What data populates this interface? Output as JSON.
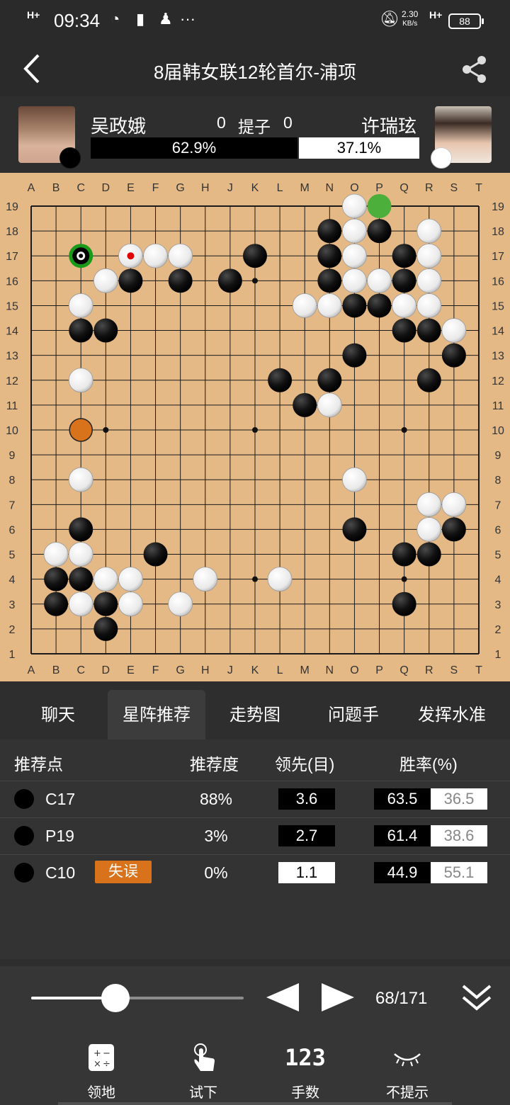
{
  "status": {
    "network": "H+",
    "time": "09:34",
    "speed": "2.30",
    "speed_unit": "KB/s",
    "net2": "H+",
    "battery": "88"
  },
  "header": {
    "title": "8届韩女联12轮首尔-浦项",
    "back_icon": "chevron-left-icon",
    "share_icon": "share-icon"
  },
  "players": {
    "black": {
      "name": "吴政娥",
      "captures": "0",
      "stone": "black"
    },
    "white": {
      "name": "许瑞玹",
      "captures": "0",
      "stone": "white"
    },
    "captures_label": "提子",
    "black_winrate": "62.9%",
    "white_winrate": "37.1%",
    "black_winrate_value": 62.9
  },
  "board": {
    "size": 19,
    "columns": [
      "A",
      "B",
      "C",
      "D",
      "E",
      "F",
      "G",
      "H",
      "J",
      "K",
      "L",
      "M",
      "N",
      "O",
      "P",
      "Q",
      "R",
      "S",
      "T"
    ],
    "rows": [
      "19",
      "18",
      "17",
      "16",
      "15",
      "14",
      "13",
      "12",
      "11",
      "10",
      "9",
      "8",
      "7",
      "6",
      "5",
      "4",
      "3",
      "2",
      "1"
    ],
    "black_stones": [
      "N18",
      "P18",
      "N17",
      "Q17",
      "K17",
      "E16",
      "G16",
      "J16",
      "N16",
      "Q16",
      "O15",
      "P15",
      "C14",
      "D14",
      "Q14",
      "R14",
      "O13",
      "S13",
      "L12",
      "N12",
      "R12",
      "M11",
      "C6",
      "O6",
      "S6",
      "F5",
      "Q5",
      "R5",
      "B4",
      "C4",
      "B3",
      "D3",
      "Q3",
      "D2"
    ],
    "white_stones": [
      "O19",
      "O18",
      "R18",
      "E17",
      "F17",
      "G17",
      "O17",
      "R17",
      "D16",
      "O16",
      "P16",
      "R16",
      "C15",
      "M15",
      "N15",
      "Q15",
      "R15",
      "S14",
      "C12",
      "N11",
      "C8",
      "O8",
      "R7",
      "S7",
      "R6",
      "B5",
      "C5",
      "D4",
      "E4",
      "H4",
      "L4",
      "C3",
      "E3",
      "G3"
    ],
    "last_move": "E17",
    "recommended_marker": "C17",
    "alt_marker": "P19",
    "mistake_marker": "C10",
    "star_points": [
      "D16",
      "K16",
      "Q16",
      "D10",
      "K10",
      "Q10",
      "D4",
      "K4",
      "Q4"
    ]
  },
  "tabs": [
    {
      "label": "聊天",
      "active": false
    },
    {
      "label": "星阵推荐",
      "active": true
    },
    {
      "label": "走势图",
      "active": false
    },
    {
      "label": "问题手",
      "active": false
    },
    {
      "label": "发挥水准",
      "active": false
    }
  ],
  "recommendations": {
    "headers": {
      "point": "推荐点",
      "degree": "推荐度",
      "lead": "领先(目)",
      "winrate": "胜率(%)"
    },
    "rows": [
      {
        "point": "C17",
        "tag": "",
        "degree": "88%",
        "lead": "3.6",
        "lead_color": "black",
        "black_wr": "63.5",
        "white_wr": "36.5"
      },
      {
        "point": "P19",
        "tag": "",
        "degree": "3%",
        "lead": "2.7",
        "lead_color": "black",
        "black_wr": "61.4",
        "white_wr": "38.6"
      },
      {
        "point": "C10",
        "tag": "失误",
        "degree": "0%",
        "lead": "1.1",
        "lead_color": "white",
        "black_wr": "44.9",
        "white_wr": "55.1"
      }
    ]
  },
  "controls": {
    "move_current": 68,
    "move_total": 171,
    "move_display": "68/171",
    "progress_fraction": 0.3976,
    "prev_icon": "triangle-left-icon",
    "next_icon": "triangle-right-icon",
    "collapse_icon": "double-chevron-down-icon"
  },
  "toolbar": [
    {
      "label": "领地",
      "icon": "calculator-icon"
    },
    {
      "label": "试下",
      "icon": "tap-hand-icon"
    },
    {
      "label": "手数",
      "icon": "number-123-icon",
      "icon_text": "123"
    },
    {
      "label": "不提示",
      "icon": "eye-closed-icon"
    }
  ],
  "colors": {
    "board": "#e4b986",
    "mistake_tag": "#d9731b",
    "recommend_ring": "#1a9a1a",
    "alt_marker": "#4caf3c",
    "mistake_marker": "#d9731b",
    "last_move_dot": "#e00000"
  }
}
